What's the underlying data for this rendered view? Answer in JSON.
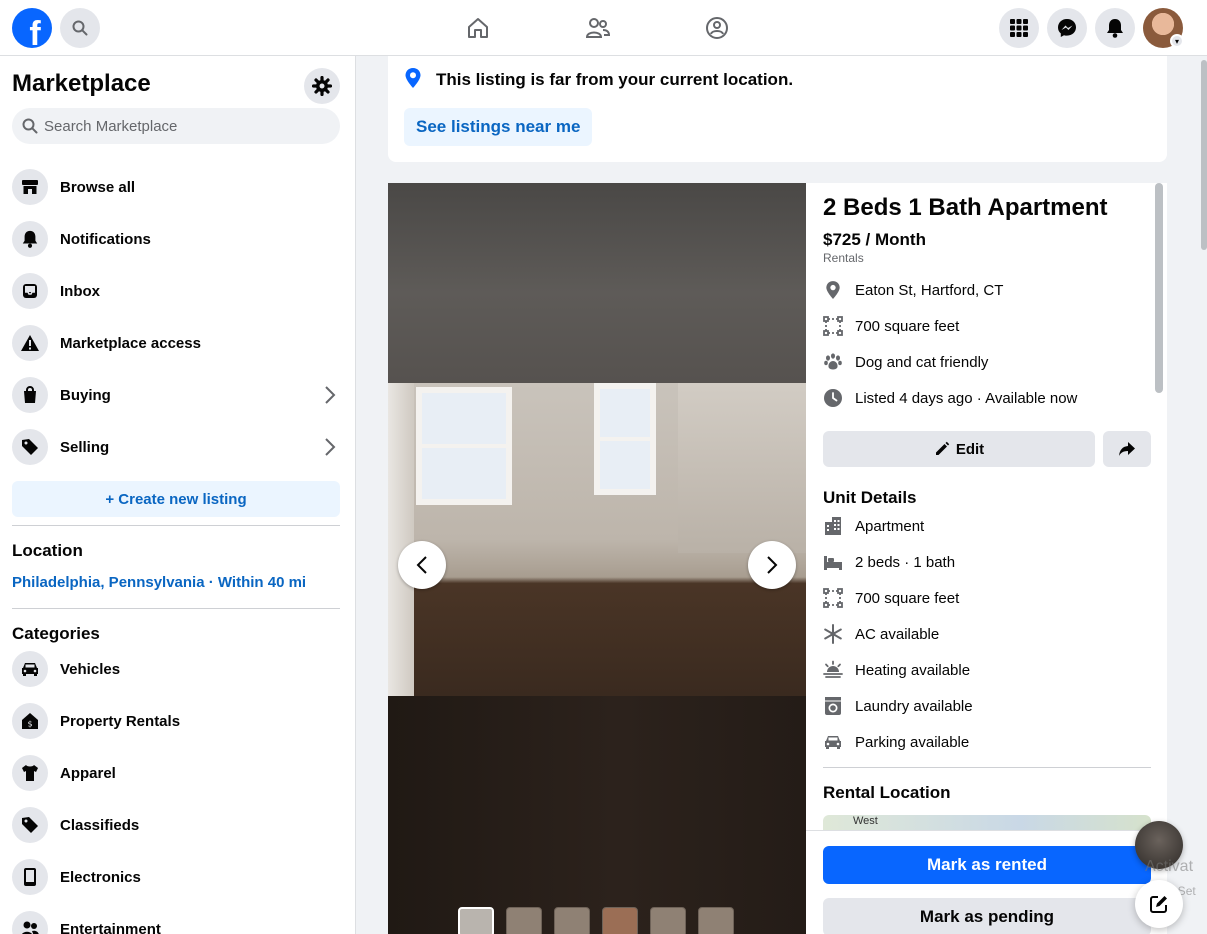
{
  "header": {
    "logo_letter": "f"
  },
  "sidebar": {
    "title": "Marketplace",
    "search_placeholder": "Search Marketplace",
    "items": [
      {
        "label": "Browse all",
        "icon": "storefront-icon"
      },
      {
        "label": "Notifications",
        "icon": "bell-icon"
      },
      {
        "label": "Inbox",
        "icon": "inbox-icon"
      },
      {
        "label": "Marketplace access",
        "icon": "warning-icon"
      },
      {
        "label": "Buying",
        "icon": "shopping-bag-icon"
      },
      {
        "label": "Selling",
        "icon": "price-tag-icon"
      }
    ],
    "create_label": "+ Create new listing",
    "location_heading": "Location",
    "location_value": "Philadelphia, Pennsylvania · Within 40 mi",
    "categories_heading": "Categories",
    "categories": [
      {
        "label": "Vehicles",
        "icon": "car-icon"
      },
      {
        "label": "Property Rentals",
        "icon": "house-dollar-icon"
      },
      {
        "label": "Apparel",
        "icon": "shirt-icon"
      },
      {
        "label": "Classifieds",
        "icon": "tags-icon"
      },
      {
        "label": "Electronics",
        "icon": "phone-icon"
      },
      {
        "label": "Entertainment",
        "icon": "people-icon"
      }
    ]
  },
  "notice": {
    "text": "This listing is far from your current location.",
    "button": "See listings near me"
  },
  "listing": {
    "title": "2 Beds 1 Bath Apartment",
    "price": "$725 / Month",
    "category": "Rentals",
    "facts": [
      {
        "text": "Eaton St, Hartford, CT",
        "icon": "location-pin-icon"
      },
      {
        "text": "700 square feet",
        "icon": "area-icon"
      },
      {
        "text": "Dog and cat friendly",
        "icon": "paw-icon"
      },
      {
        "text": "Listed 4 days ago · Available now",
        "icon": "clock-icon"
      }
    ],
    "edit_label": "Edit",
    "unit_heading": "Unit Details",
    "unit_details": [
      {
        "text": "Apartment",
        "icon": "building-icon"
      },
      {
        "text": "2 beds · 1 bath",
        "icon": "bed-icon"
      },
      {
        "text": "700 square feet",
        "icon": "area-icon"
      },
      {
        "text": "AC available",
        "icon": "snowflake-icon"
      },
      {
        "text": "Heating available",
        "icon": "heating-icon"
      },
      {
        "text": "Laundry available",
        "icon": "washer-icon"
      },
      {
        "text": "Parking available",
        "icon": "car-icon"
      }
    ],
    "rental_location_heading": "Rental Location",
    "map_label": "West",
    "mark_rented": "Mark as rented",
    "mark_pending": "Mark as pending"
  },
  "watermark": {
    "line1": "Activat",
    "line2": "Go to Set"
  },
  "colors": {
    "accent": "#0866ff",
    "link": "#0a66c2",
    "light_accent_bg": "#ebf5ff",
    "secondary_bg": "#e4e6eb"
  }
}
